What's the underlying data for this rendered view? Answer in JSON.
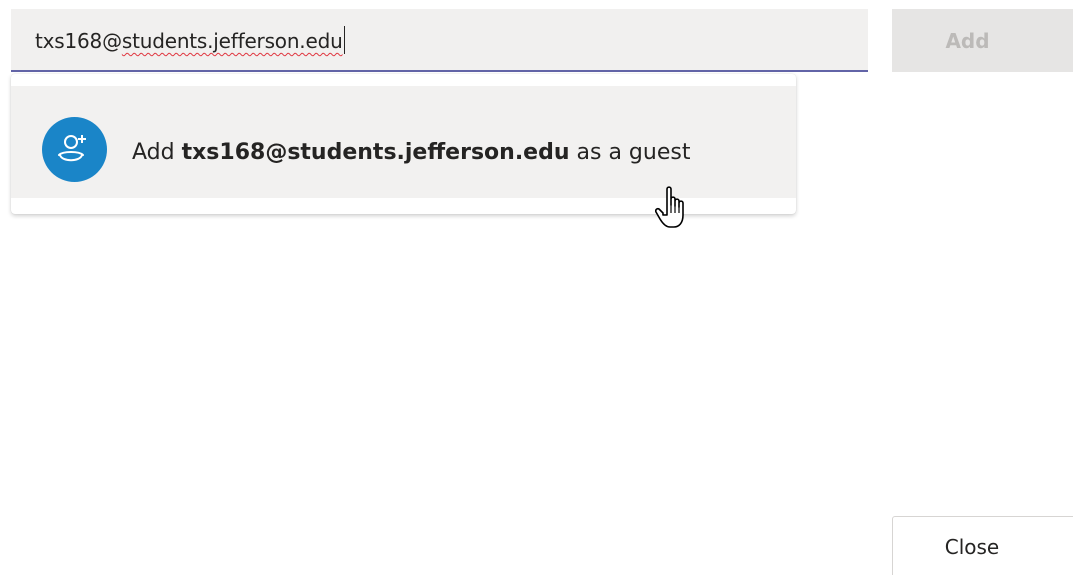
{
  "input": {
    "value_user": "txs168@",
    "value_domain": "students.jefferson.edu"
  },
  "buttons": {
    "add_label": "Add",
    "close_label": "Close"
  },
  "suggestion": {
    "prefix": "Add ",
    "email": "txs168@students.jefferson.edu",
    "suffix": " as a guest",
    "icon": "add-guest-icon"
  },
  "colors": {
    "accent": "#6264a7",
    "avatar": "#1a85c8",
    "spellcheck": "#e0353f"
  }
}
